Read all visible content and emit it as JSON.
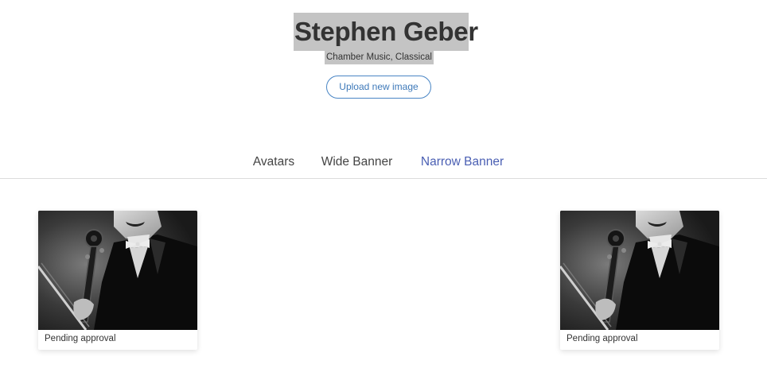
{
  "profile": {
    "name": "Stephen Geber",
    "genres": "Chamber Music, Classical",
    "upload_button": "Upload new image"
  },
  "tabs": [
    {
      "label": "Avatars",
      "active": false
    },
    {
      "label": "Wide Banner",
      "active": false
    },
    {
      "label": "Narrow Banner",
      "active": true
    }
  ],
  "images": [
    {
      "status": "Pending approval",
      "photo": "cellist-photo"
    },
    {
      "status": "Pending approval",
      "photo": "cellist-photo"
    }
  ],
  "colors": {
    "accent": "#4a5fb3",
    "button_border": "#4a86c5",
    "highlight": "#c4c4c4"
  }
}
